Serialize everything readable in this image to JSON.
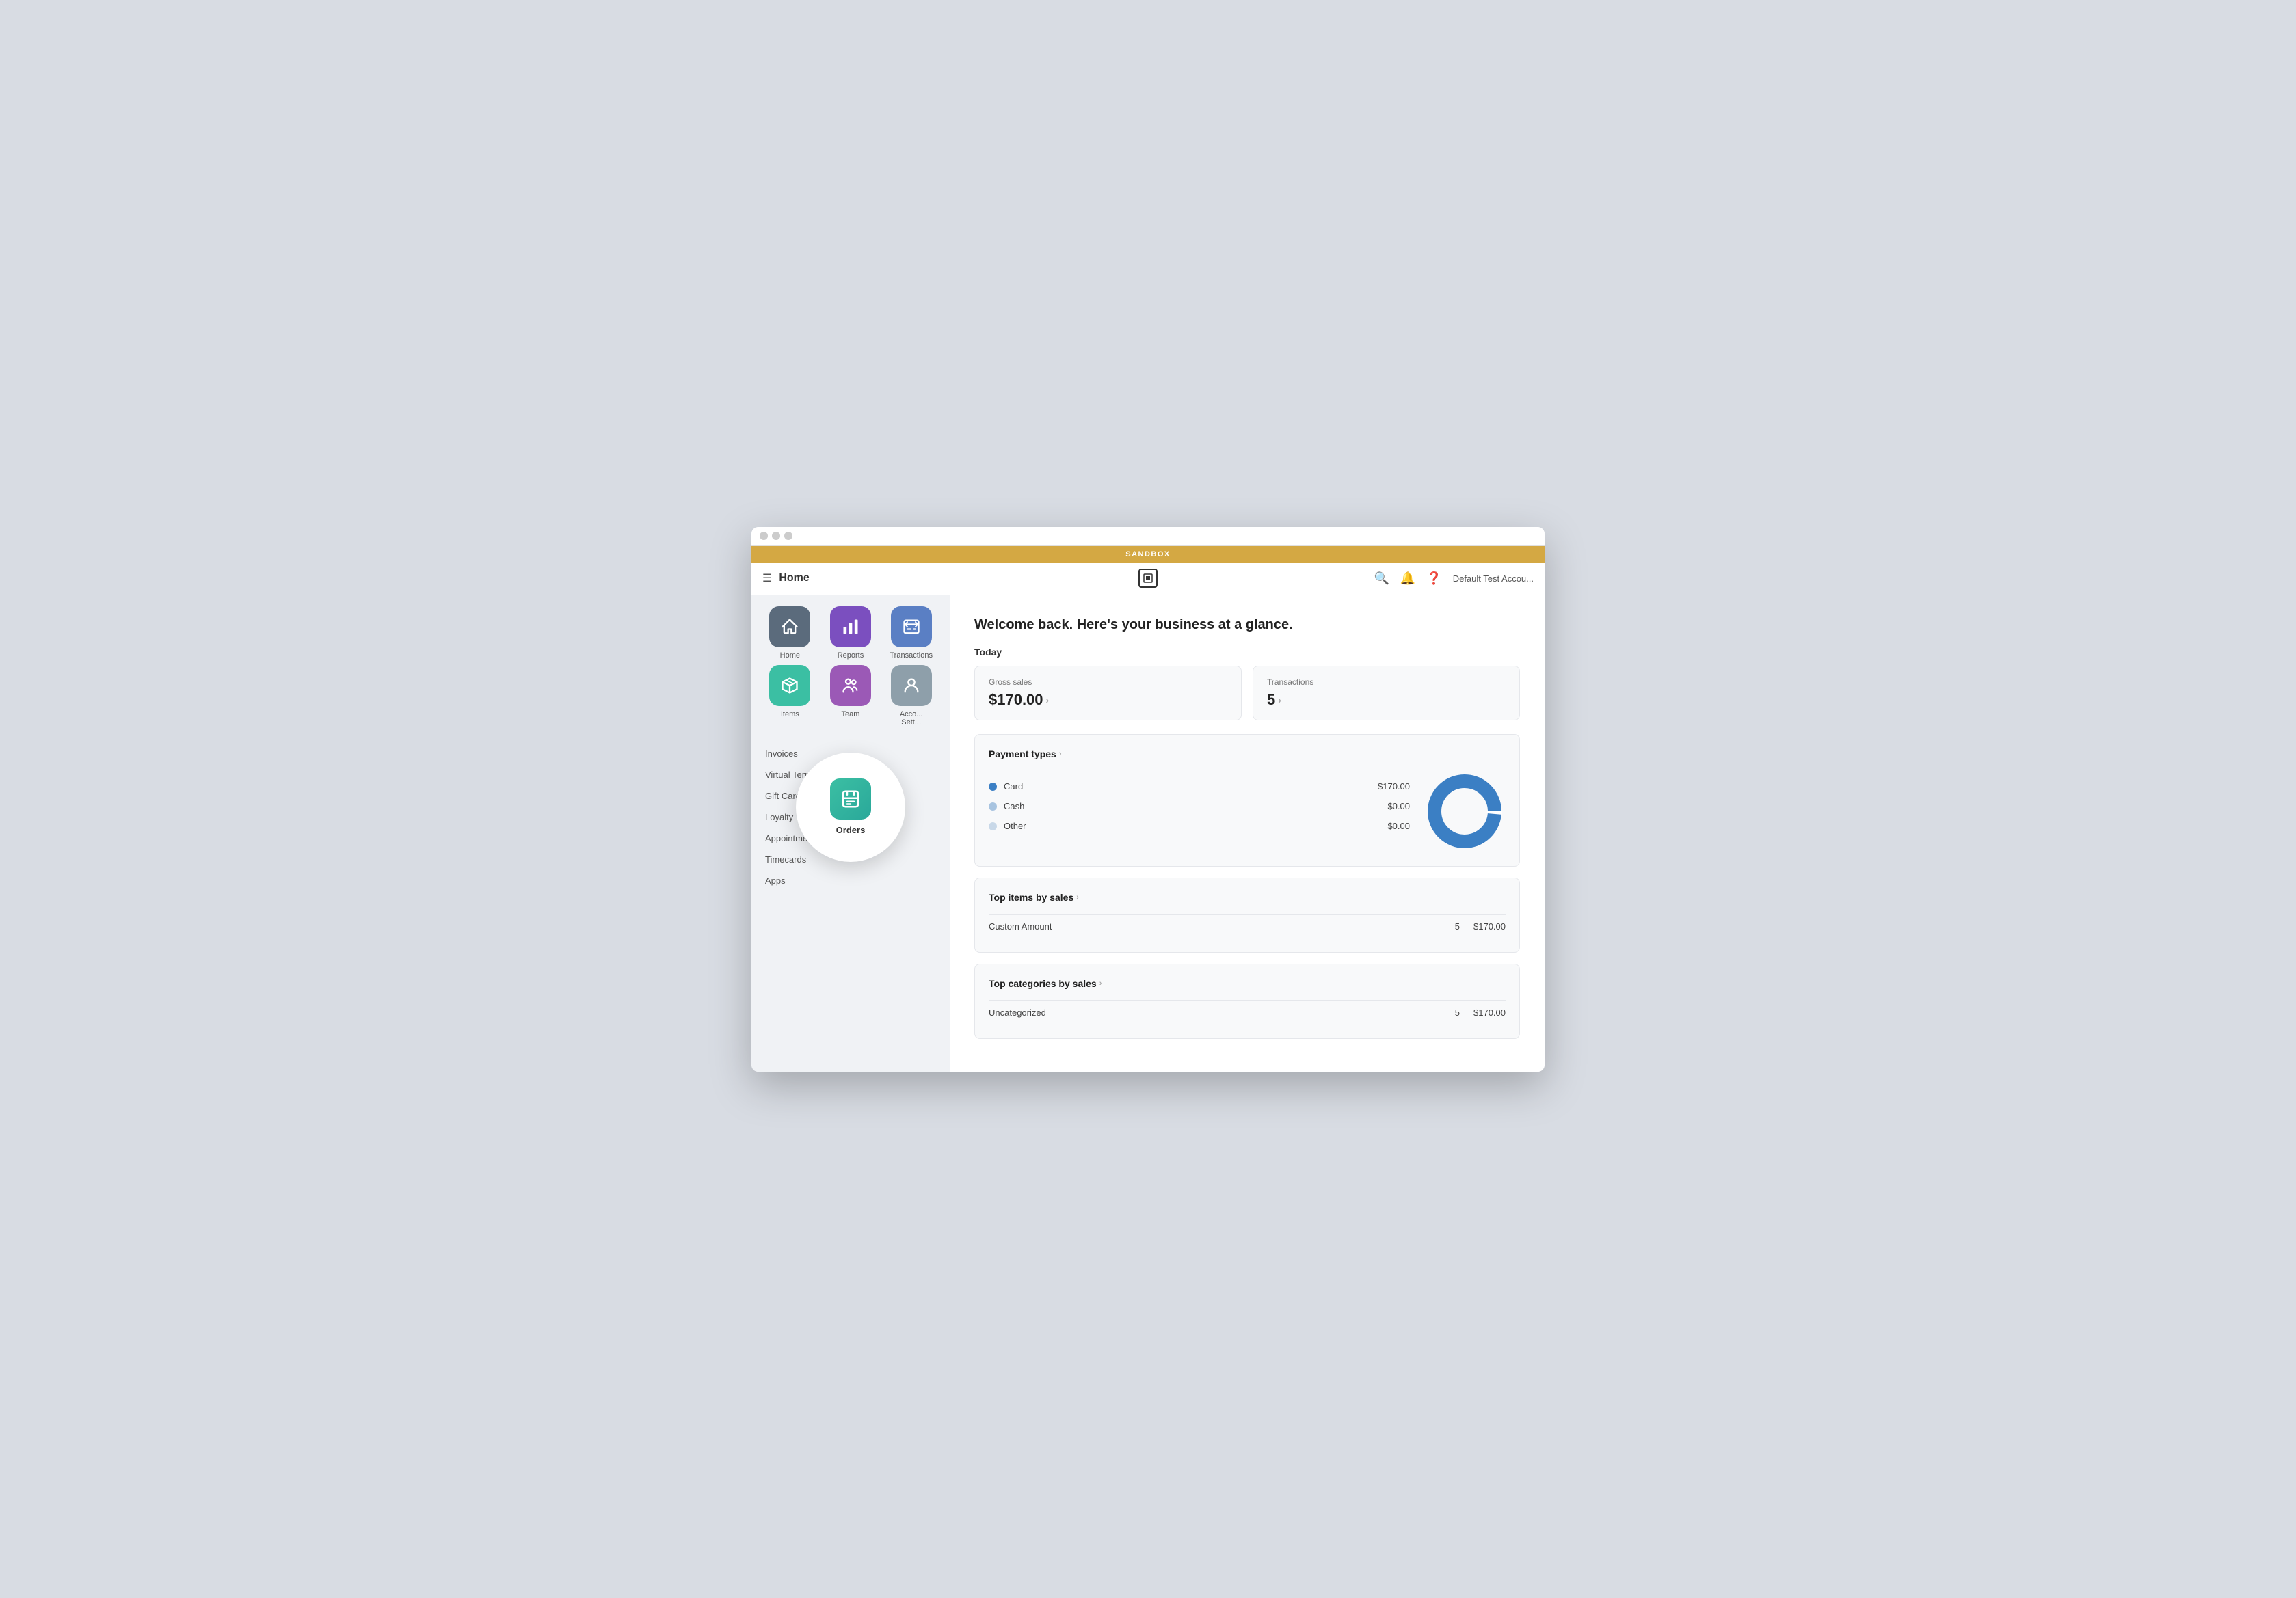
{
  "window": {
    "sandbox_label": "SANDBOX"
  },
  "header": {
    "title": "Home",
    "account_text": "Default Test Accou..."
  },
  "sidebar": {
    "nav_items": [
      {
        "id": "home",
        "label": "Home",
        "color_class": "icon-home"
      },
      {
        "id": "reports",
        "label": "Reports",
        "color_class": "icon-reports"
      },
      {
        "id": "transactions",
        "label": "Transactions",
        "color_class": "icon-transactions"
      },
      {
        "id": "items",
        "label": "Items",
        "color_class": "icon-items"
      },
      {
        "id": "team",
        "label": "Team",
        "color_class": "icon-team-members"
      },
      {
        "id": "account-settings",
        "label": "Acco... Sett...",
        "color_class": "icon-account"
      }
    ],
    "orders_tooltip_label": "Orders",
    "links": [
      {
        "id": "invoices",
        "label": "Invoices"
      },
      {
        "id": "virtual-terminal",
        "label": "Virtual Terminal"
      },
      {
        "id": "gift-cards",
        "label": "Gift Cards"
      },
      {
        "id": "loyalty",
        "label": "Loyalty"
      },
      {
        "id": "appointments",
        "label": "Appointments"
      },
      {
        "id": "timecards",
        "label": "Timecards"
      },
      {
        "id": "apps",
        "label": "Apps"
      }
    ]
  },
  "main": {
    "welcome_text": "Welcome back. Here's your business at a glance.",
    "today_label": "Today",
    "gross_sales": {
      "title": "Gross sales",
      "value": "$170.00"
    },
    "transactions": {
      "title": "Transactions",
      "value": "5"
    },
    "payment_types": {
      "title": "Payment types",
      "items": [
        {
          "name": "Card",
          "amount": "$170.00",
          "dot_class": "dot-card"
        },
        {
          "name": "Cash",
          "amount": "$0.00",
          "dot_class": "dot-cash"
        },
        {
          "name": "Other",
          "amount": "$0.00",
          "dot_class": "dot-other"
        }
      ]
    },
    "top_items_by_sales": {
      "title": "Top items by sales",
      "rows": [
        {
          "name": "Custom Amount",
          "count": "5",
          "amount": "$170.00"
        }
      ]
    },
    "top_categories_by_sales": {
      "title": "Top categories by sales"
    }
  }
}
